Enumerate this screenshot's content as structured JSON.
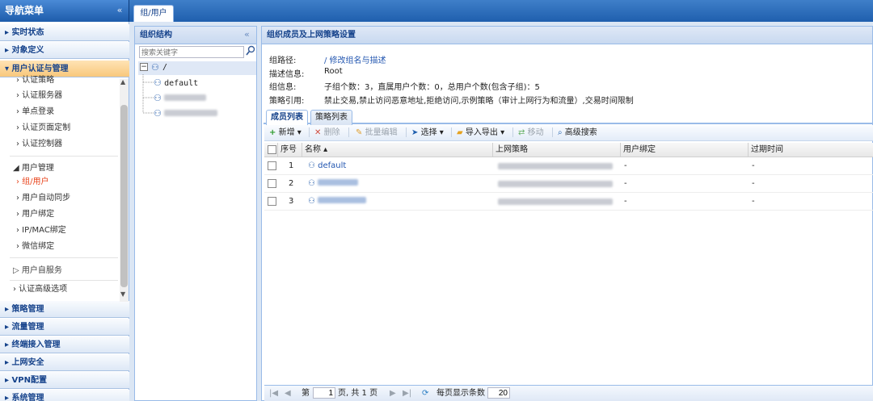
{
  "sidebar": {
    "title": "导航菜单",
    "collapse_icon": "«",
    "sections": [
      {
        "label": "▸ 实时状态"
      },
      {
        "label": "▸ 对象定义"
      },
      {
        "label": "▾ 用户认证与管理"
      },
      {
        "label": "▸ 策略管理"
      },
      {
        "label": "▸ 流量管理"
      },
      {
        "label": "▸ 终端接入管理"
      },
      {
        "label": "▸ 上网安全"
      },
      {
        "label": "▸ VPN配置"
      },
      {
        "label": "▸ 系统管理"
      }
    ],
    "auth_items": [
      "› 认证策略",
      "› 认证服务器",
      "› 单点登录",
      "› 认证页面定制",
      "› 认证控制器"
    ],
    "user_mgmt": {
      "label": "◢ 用户管理",
      "items": [
        "› 组/用户",
        "› 用户自动同步",
        "› 用户绑定",
        "› IP/MAC绑定",
        "› 微信绑定"
      ]
    },
    "self_service": "▷ 用户自服务",
    "advanced": "› 认证高级选项"
  },
  "main_tab": "组/用户",
  "org": {
    "header": "组织结构",
    "collapse_icon": "«",
    "search_placeholder": "搜索关键字",
    "root": "/",
    "children": [
      "default"
    ]
  },
  "detail": {
    "header": "组织成员及上网策略设置",
    "path_label": "组路径:",
    "path_value": "/ 修改组名与描述",
    "desc_label": "描述信息:",
    "desc_value": "Root",
    "group_label": "组信息:",
    "group_value": "子组个数：3，直属用户个数：0，总用户个数(包含子组)：5",
    "policy_label": "策略引用:",
    "policy_value": "禁止交易,禁止访问恶意地址,拒绝访问,示例策略（审计上网行为和流量）,交易时间限制",
    "tabs": [
      "成员列表",
      "策略列表"
    ]
  },
  "toolbar": {
    "add": "新增",
    "delete": "删除",
    "batch_edit": "批量编辑",
    "select": "选择",
    "import_export": "导入导出",
    "move": "移动",
    "advanced_search": "高级搜索"
  },
  "grid": {
    "columns": [
      "序号",
      "名称 ▴",
      "上网策略",
      "用户绑定",
      "过期时间"
    ],
    "rows": [
      {
        "index": "1",
        "name": "default",
        "binding": "-",
        "expiry": "-"
      },
      {
        "index": "2",
        "name": "",
        "binding": "-",
        "expiry": "-"
      },
      {
        "index": "3",
        "name": "",
        "binding": "-",
        "expiry": "-"
      }
    ]
  },
  "pager": {
    "page_prefix": "第",
    "page": "1",
    "page_suffix": "页, 共 1 页",
    "per_page_label": "每页显示条数",
    "per_page": "20"
  },
  "colors": {
    "accent": "#1f5fae",
    "active_section": "#f8c87c",
    "selected_item": "#e8441c",
    "link": "#2256b0"
  }
}
